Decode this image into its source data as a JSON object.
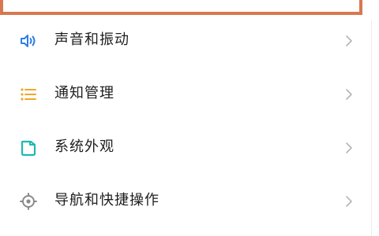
{
  "colors": {
    "accent_blue": "#2f7fe8",
    "accent_orange": "#f2a62a",
    "accent_teal": "#20b8b2",
    "icon_gray": "#8a8a8a",
    "highlight_border": "#d8784f",
    "text": "#1e1e1e",
    "chevron": "#b5b5b5"
  },
  "settings": {
    "items": [
      {
        "label": "声音和振动",
        "icon": "speaker-icon"
      },
      {
        "label": "通知管理",
        "icon": "list-icon"
      },
      {
        "label": "系统外观",
        "icon": "appearance-icon"
      },
      {
        "label": "导航和快捷操作",
        "icon": "navigation-icon"
      }
    ]
  }
}
